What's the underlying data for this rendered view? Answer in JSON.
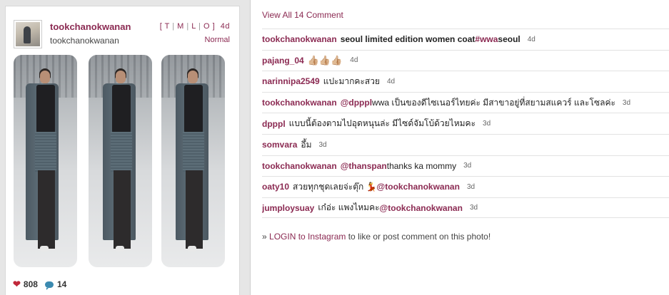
{
  "post": {
    "username": "tookchanokwanan",
    "fullname": "tookchanokwanan",
    "links": [
      "T",
      "M",
      "L",
      "O"
    ],
    "age": "4d",
    "filter": "Normal",
    "likes": "808",
    "comments_count": "14"
  },
  "comments_panel": {
    "view_all_label": "View All 14 Comment",
    "items": [
      {
        "user": "tookchanokwanan",
        "text": "seoul limited edition women coat ",
        "hashtag": "#wwa",
        "after": " seoul",
        "time": "4d"
      },
      {
        "user": "pajang_04",
        "text": "👍🏼👍🏼👍🏼",
        "time": "4d"
      },
      {
        "user": "narinnipa2549",
        "text": "แปะมากคะสวย",
        "time": "4d"
      },
      {
        "user": "tookchanokwanan",
        "mention": "@dpppl",
        "text": " wwa เป็นของดีไซเนอร์ไทยค่ะ มีสาขาอยู่ที่สยามสแควร์ และโซลค่ะ",
        "time": "3d"
      },
      {
        "user": "dpppl",
        "text": "แบบนี้ต้องตามไปอุดหนุนล่ะ มีไซด์จัมโบ้ด้วยไหมคะ",
        "time": "3d"
      },
      {
        "user": "somvara",
        "text": "อึ้ม",
        "time": "3d"
      },
      {
        "user": "tookchanokwanan",
        "mention": "@thanspan",
        "text": " thanks ka mommy",
        "time": "3d"
      },
      {
        "user": "oaty10",
        "text": "สวยทุกชุดเลยจ่ะตุ๊ก 💃 ",
        "mention2": "@tookchanokwanan",
        "time": "3d"
      },
      {
        "user": "jumploysuay",
        "text": "เก๋อ่ะ แพงไหมคะ ",
        "mention2": "@tookchanokwanan",
        "time": "3d"
      }
    ],
    "login_prefix": "» ",
    "login_link": "LOGIN to Instagram",
    "login_suffix": " to like or post comment on this photo!"
  },
  "colors": {
    "accent": "#8b2a52",
    "heart": "#c0283a",
    "bubble": "#3b8ab0"
  },
  "icons": [
    "heart-icon",
    "comment-bubble-icon"
  ]
}
